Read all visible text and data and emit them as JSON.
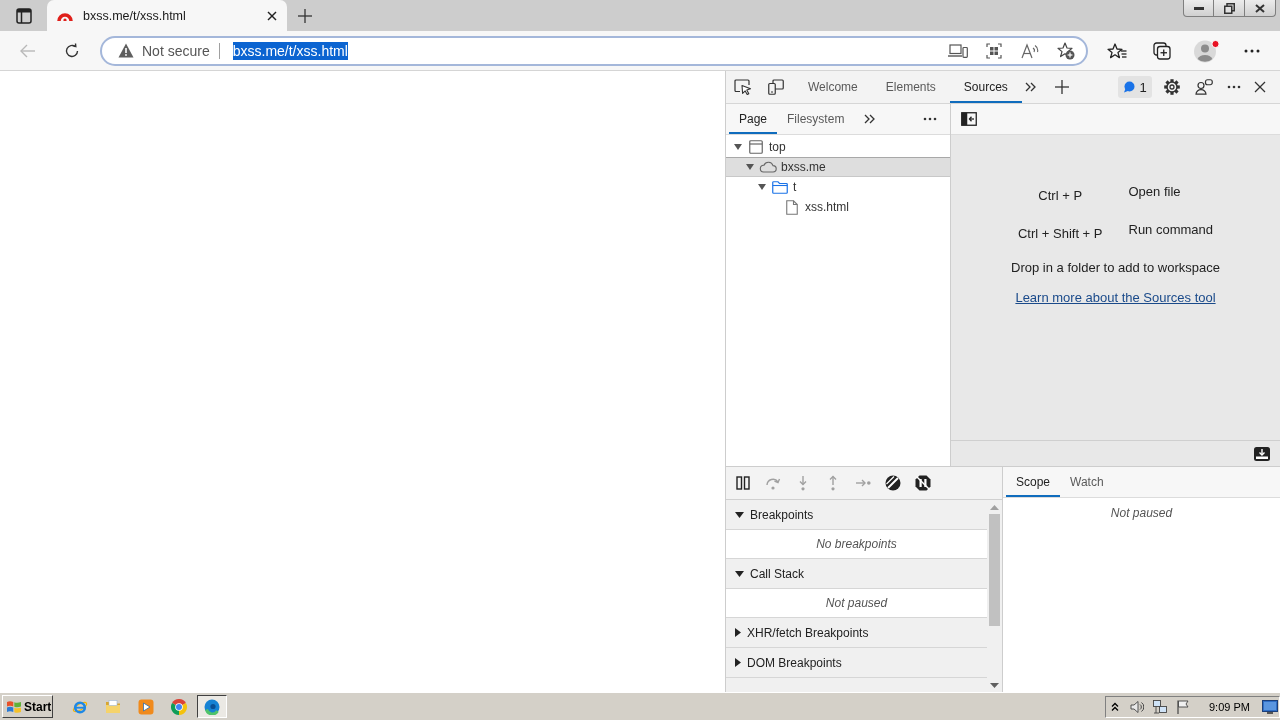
{
  "browser": {
    "tabs": [
      {
        "title": "bxss.me/t/xss.html",
        "selected": true
      }
    ],
    "back_disabled": true,
    "address_bar": {
      "security_label": "Not secure",
      "url": "bxss.me/t/xss.html",
      "url_selected": true
    },
    "profile_notification": true
  },
  "devtools": {
    "tabs": [
      {
        "label": "Welcome",
        "selected": false
      },
      {
        "label": "Elements",
        "selected": false
      },
      {
        "label": "Sources",
        "selected": true
      }
    ],
    "issues_count": "1",
    "navigator": {
      "tabs": [
        {
          "label": "Page",
          "selected": true
        },
        {
          "label": "Filesystem",
          "selected": false
        }
      ],
      "tree": [
        {
          "label": "top",
          "kind": "frame",
          "expanded": true,
          "selected": false,
          "children": [
            {
              "label": "bxss.me",
              "kind": "domain",
              "expanded": true,
              "selected": true,
              "children": [
                {
                  "label": "t",
                  "kind": "folder",
                  "expanded": true,
                  "selected": false,
                  "children": [
                    {
                      "label": "xss.html",
                      "kind": "file",
                      "selected": false
                    }
                  ]
                }
              ]
            }
          ]
        }
      ]
    },
    "editor": {
      "shortcuts": [
        {
          "keys": "Ctrl + P",
          "action": "Open file"
        },
        {
          "keys": "Ctrl + Shift + P",
          "action": "Run command"
        }
      ],
      "drop_hint": "Drop in a folder to add to workspace",
      "learn_more_link": "Learn more about the Sources tool"
    },
    "debugger": {
      "toolbar": [
        {
          "kind": "pause",
          "disabled": false
        },
        {
          "kind": "step-over",
          "disabled": true
        },
        {
          "kind": "step-into",
          "disabled": true
        },
        {
          "kind": "step-out",
          "disabled": true
        },
        {
          "kind": "step",
          "disabled": true
        },
        {
          "kind": "deactivate-breakpoints",
          "disabled": false
        },
        {
          "kind": "pause-on-exceptions",
          "disabled": false
        }
      ],
      "sections": [
        {
          "title": "Breakpoints",
          "expanded": true,
          "empty_text": "No breakpoints"
        },
        {
          "title": "Call Stack",
          "expanded": true,
          "empty_text": "Not paused"
        },
        {
          "title": "XHR/fetch Breakpoints",
          "expanded": false
        },
        {
          "title": "DOM Breakpoints",
          "expanded": false
        }
      ],
      "sidebar_tabs": [
        {
          "label": "Scope",
          "selected": true
        },
        {
          "label": "Watch",
          "selected": false
        }
      ],
      "scope_message": "Not paused"
    }
  },
  "taskbar": {
    "start_label": "Start",
    "apps": [
      {
        "kind": "ie",
        "selected": false
      },
      {
        "kind": "folder",
        "selected": false
      },
      {
        "kind": "media",
        "selected": false
      },
      {
        "kind": "chrome",
        "selected": false
      },
      {
        "kind": "edge",
        "selected": true
      }
    ],
    "clock": "9:09 PM"
  }
}
